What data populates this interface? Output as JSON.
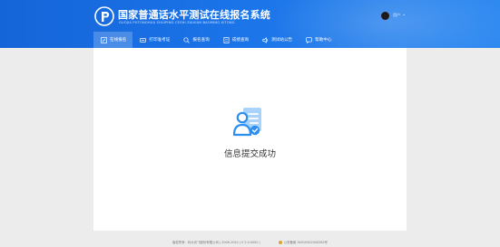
{
  "header": {
    "title": "国家普通话水平测试在线报名系统",
    "subtitle": "GUOJIA PUTONGHUA SHUIPING CESHI ZAIXIAN BAOMING XITONG",
    "user_name": "用户"
  },
  "nav": {
    "items": [
      {
        "label": "在线报名",
        "icon": "edit-icon",
        "active": true
      },
      {
        "label": "打印准考证",
        "icon": "ticket-icon",
        "active": false
      },
      {
        "label": "报名查询",
        "icon": "search-icon",
        "active": false
      },
      {
        "label": "成绩查询",
        "icon": "document-icon",
        "active": false
      },
      {
        "label": "测试站公告",
        "icon": "speaker-icon",
        "active": false
      },
      {
        "label": "帮助中心",
        "icon": "help-icon",
        "active": false
      }
    ]
  },
  "main": {
    "success_message": "信息提交成功",
    "icon": "user-profile-icon"
  },
  "footer": {
    "copyright": "版权所有：科大讯飞股份有限公司 | 2006-2020 | V 2.0.0000 |",
    "police_record": "公安备案 34010302000262号"
  },
  "colors": {
    "brand": "#1a73e8",
    "icon_blue": "#2b8ef0",
    "icon_light": "#a9d3fb"
  }
}
